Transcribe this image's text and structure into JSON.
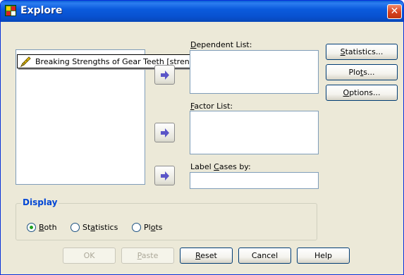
{
  "window": {
    "title": "Explore",
    "close_glyph": "✕"
  },
  "source_list": {
    "items": [
      {
        "label": "Breaking Strengths of Gear Teeth [strength]",
        "icon": "pencil-ruler-icon"
      }
    ]
  },
  "dependent_list": {
    "label_mnemonic": "D",
    "label_rest": "ependent List:",
    "items": []
  },
  "factor_list": {
    "label_mnemonic": "F",
    "label_rest": "actor List:",
    "items": []
  },
  "label_cases_by": {
    "label_pre": "Label ",
    "label_mnemonic": "C",
    "label_post": "ases by:",
    "value": ""
  },
  "side_buttons": {
    "statistics": {
      "mnemonic": "S",
      "rest": "tatistics..."
    },
    "plots": {
      "pre": "Plo",
      "mnemonic": "t",
      "post": "s..."
    },
    "options": {
      "mnemonic": "O",
      "rest": "ptions..."
    }
  },
  "display": {
    "legend": "Display",
    "selected": "Both",
    "options": [
      {
        "mnemonic": "B",
        "rest": "oth"
      },
      {
        "pre": "St",
        "mnemonic": "a",
        "post": "tistics"
      },
      {
        "pre": "Pl",
        "mnemonic": "o",
        "post": "ts"
      }
    ]
  },
  "bottom_buttons": {
    "ok": "OK",
    "paste": {
      "mnemonic": "P",
      "rest": "aste"
    },
    "reset": {
      "mnemonic": "R",
      "rest": "eset"
    },
    "cancel": "Cancel",
    "help": "Help"
  },
  "colors": {
    "title_bar": "#0b5bdd",
    "dialog_bg": "#ece9d8",
    "group_legend": "#0046d5",
    "radio_selected": "#21a121",
    "arrow": "#5a55c8"
  }
}
